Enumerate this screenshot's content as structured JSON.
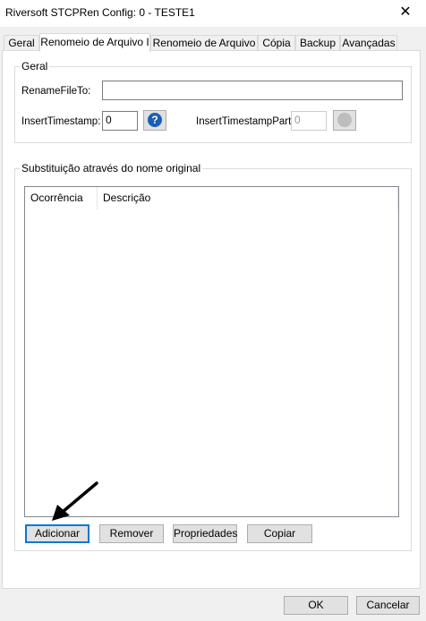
{
  "window": {
    "title": "Riversoft STCPRen Config: 0 - TESTE1",
    "close_glyph": "✕"
  },
  "tabs": [
    {
      "label": "Geral"
    },
    {
      "label": "Renomeio de Arquivo I"
    },
    {
      "label": "Renomeio de Arquivo II"
    },
    {
      "label": "Cópia"
    },
    {
      "label": "Backup"
    },
    {
      "label": "Avançadas"
    }
  ],
  "geral_group": {
    "legend": "Geral",
    "rename_label": "RenameFileTo:",
    "rename_value": "",
    "timestamp_label": "InsertTimestamp:",
    "timestamp_value": "0",
    "timestamp_part_label": "InsertTimestampPart:",
    "timestamp_part_value": "0",
    "help_glyph": "?"
  },
  "subst_group": {
    "legend": "Substituição através do nome original",
    "columns": [
      {
        "label": "Ocorrência"
      },
      {
        "label": "Descrição"
      }
    ]
  },
  "buttons": {
    "add": "Adicionar",
    "remove": "Remover",
    "properties": "Propriedades",
    "copy": "Copiar",
    "ok": "OK",
    "cancel": "Cancelar"
  },
  "colors": {
    "help_icon": "#1a5fb4",
    "focus": "#0078d7"
  }
}
